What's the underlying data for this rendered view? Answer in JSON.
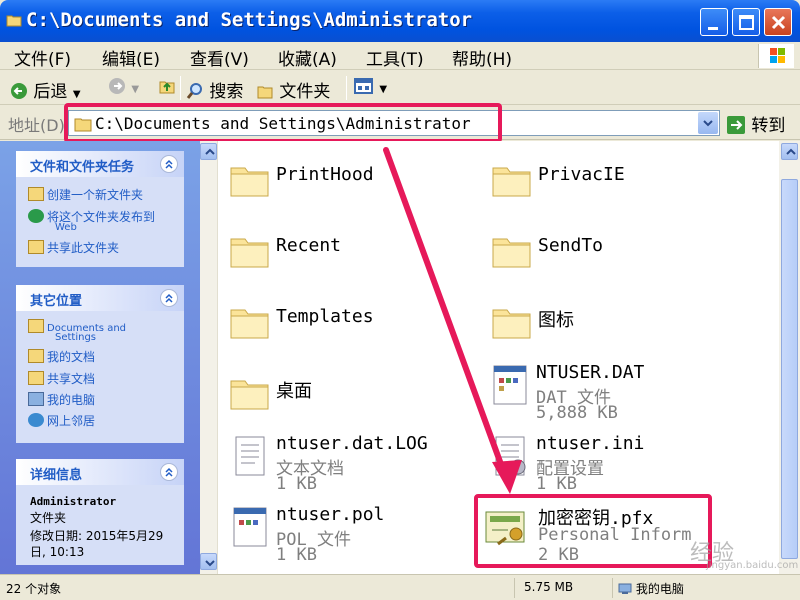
{
  "window": {
    "title": "C:\\Documents and Settings\\Administrator"
  },
  "menu": [
    "文件(F)",
    "编辑(E)",
    "查看(V)",
    "收藏(A)",
    "工具(T)",
    "帮助(H)"
  ],
  "toolbar": {
    "back": "后退",
    "search": "搜索",
    "folders": "文件夹"
  },
  "address": {
    "label": "地址(D)",
    "path": "C:\\Documents and Settings\\Administrator",
    "go": "转到"
  },
  "tasks": {
    "title": "文件和文件夹任务",
    "items": [
      "创建一个新文件夹",
      "将这个文件夹发布到",
      "Web",
      "共享此文件夹"
    ]
  },
  "places": {
    "title": "其它位置",
    "items": [
      "Documents and",
      "Settings",
      "我的文档",
      "共享文档",
      "我的电脑",
      "网上邻居"
    ]
  },
  "details": {
    "title": "详细信息",
    "name": "Administrator",
    "type": "文件夹",
    "modified": "修改日期: 2015年5月29",
    "modified2": "日, 10:13"
  },
  "files": [
    {
      "name": "PrintHood"
    },
    {
      "name": "PrivacIE"
    },
    {
      "name": "Recent"
    },
    {
      "name": "SendTo"
    },
    {
      "name": "Templates"
    },
    {
      "name": "图标"
    },
    {
      "name": "桌面"
    },
    {
      "name": "NTUSER.DAT",
      "type": "DAT 文件",
      "size": "5,888 KB"
    },
    {
      "name": "ntuser.dat.LOG",
      "type": "文本文档",
      "size": "1 KB"
    },
    {
      "name": "ntuser.ini",
      "type": "配置设置",
      "size": "1 KB"
    },
    {
      "name": "ntuser.pol",
      "type": "POL 文件",
      "size": "1 KB"
    },
    {
      "name": "加密密钥.pfx",
      "type": "Personal Inform",
      "size": "2 KB"
    }
  ],
  "status": {
    "count": "22 个对象",
    "size": "5.75 MB",
    "location": "我的电脑"
  },
  "watermark": {
    "main": "经验",
    "url": "jingyan.baidu.com"
  },
  "colors": {
    "highlight": "#e6195a",
    "titlebar": "#0053e0",
    "link": "#215dc6"
  }
}
